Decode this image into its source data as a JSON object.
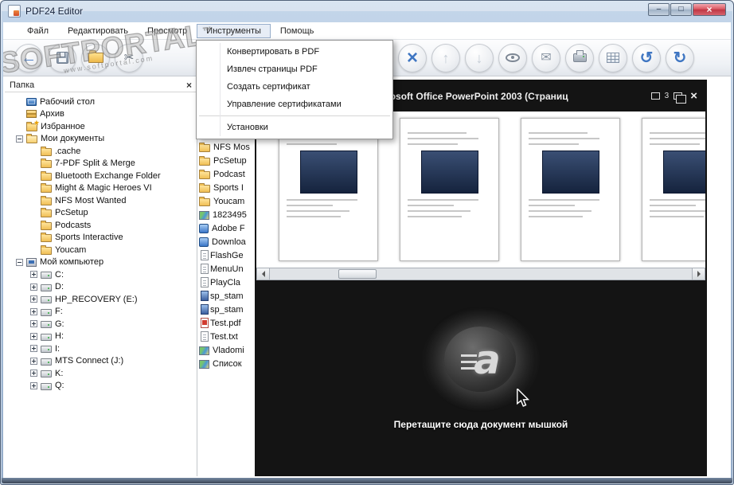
{
  "window": {
    "title": "PDF24 Editor",
    "controls": {
      "minimize": "–",
      "maximize": "□",
      "close": "×"
    }
  },
  "watermark": {
    "text": "SOFTPORTAL",
    "tm": "™",
    "subtext": "www.softportal.com"
  },
  "menubar": {
    "items": [
      {
        "label": "Файл",
        "active": false
      },
      {
        "label": "Редактировать",
        "active": false
      },
      {
        "label": "Просмотр",
        "active": false
      },
      {
        "label": "Инструменты",
        "active": true
      },
      {
        "label": "Помощь",
        "active": false
      }
    ]
  },
  "tools_menu": {
    "items": [
      {
        "label": "Конвертировать в PDF"
      },
      {
        "label": "Извлеч страницы PDF"
      },
      {
        "label": "Создать сертификат"
      },
      {
        "label": "Управление сертификатами"
      }
    ],
    "settings_item": {
      "label": "Установки"
    }
  },
  "toolbar": {
    "buttons": [
      {
        "name": "back",
        "icon": "arrow-left",
        "group": 1
      },
      {
        "name": "save",
        "icon": "save",
        "group": 1
      },
      {
        "name": "open-folder",
        "icon": "folder-open",
        "group": 1
      },
      {
        "name": "cut",
        "icon": "scissors",
        "group": 1
      },
      {
        "name": "close-document",
        "icon": "close-x",
        "group": 2
      },
      {
        "name": "page-up",
        "icon": "arrow-up",
        "group": 2
      },
      {
        "name": "page-down",
        "icon": "arrow-down",
        "group": 2
      },
      {
        "name": "preview",
        "icon": "eye",
        "group": 2
      },
      {
        "name": "email",
        "icon": "envelope",
        "group": 2
      },
      {
        "name": "print",
        "icon": "printer",
        "group": 2
      },
      {
        "name": "page-overview",
        "icon": "grid",
        "group": 2
      },
      {
        "name": "rotate-left",
        "icon": "rotate-left",
        "group": 2
      },
      {
        "name": "rotate-right",
        "icon": "rotate-right",
        "group": 2
      }
    ]
  },
  "folder_panel": {
    "title": "Папка",
    "close_label": "×",
    "tree": [
      {
        "label": "Рабочий стол",
        "icon": "desktop",
        "level": 0,
        "expander": "none"
      },
      {
        "label": "Архив",
        "icon": "archive",
        "level": 0,
        "expander": "none"
      },
      {
        "label": "Избранное",
        "icon": "favorites",
        "level": 0,
        "expander": "none"
      },
      {
        "label": "Мои документы",
        "icon": "folder-open",
        "level": 0,
        "expander": "minus"
      },
      {
        "label": ".cache",
        "icon": "folder",
        "level": 1,
        "expander": "none"
      },
      {
        "label": "7-PDF Split & Merge",
        "icon": "folder",
        "level": 1,
        "expander": "none"
      },
      {
        "label": "Bluetooth Exchange Folder",
        "icon": "folder",
        "level": 1,
        "expander": "none"
      },
      {
        "label": "Might & Magic Heroes VI",
        "icon": "folder",
        "level": 1,
        "expander": "none"
      },
      {
        "label": "NFS Most Wanted",
        "icon": "folder",
        "level": 1,
        "expander": "none"
      },
      {
        "label": "PcSetup",
        "icon": "folder",
        "level": 1,
        "expander": "none"
      },
      {
        "label": "Podcasts",
        "icon": "folder",
        "level": 1,
        "expander": "none"
      },
      {
        "label": "Sports Interactive",
        "icon": "folder",
        "level": 1,
        "expander": "none"
      },
      {
        "label": "Youcam",
        "icon": "folder",
        "level": 1,
        "expander": "none"
      },
      {
        "label": "Мой компьютер",
        "icon": "computer",
        "level": 0,
        "expander": "minus"
      },
      {
        "label": "C:",
        "icon": "drive",
        "level": 1,
        "expander": "plus"
      },
      {
        "label": "D:",
        "icon": "drive",
        "level": 1,
        "expander": "plus"
      },
      {
        "label": "HP_RECOVERY (E:)",
        "icon": "drive",
        "level": 1,
        "expander": "plus"
      },
      {
        "label": "F:",
        "icon": "drive",
        "level": 1,
        "expander": "plus"
      },
      {
        "label": "G:",
        "icon": "drive",
        "level": 1,
        "expander": "plus"
      },
      {
        "label": "H:",
        "icon": "drive",
        "level": 1,
        "expander": "plus"
      },
      {
        "label": "I:",
        "icon": "drive",
        "level": 1,
        "expander": "plus"
      },
      {
        "label": "MTS Connect (J:)",
        "icon": "drive",
        "level": 1,
        "expander": "plus"
      },
      {
        "label": "K:",
        "icon": "drive",
        "level": 1,
        "expander": "plus"
      },
      {
        "label": "Q:",
        "icon": "drive",
        "level": 1,
        "expander": "plus"
      }
    ]
  },
  "file_list": {
    "items": [
      {
        "label": "NFS Mos",
        "icon": "folder"
      },
      {
        "label": "PcSetup",
        "icon": "folder"
      },
      {
        "label": "Podcast",
        "icon": "folder"
      },
      {
        "label": "Sports I",
        "icon": "folder"
      },
      {
        "label": "Youcam",
        "icon": "folder"
      },
      {
        "label": "1823495",
        "icon": "jpg"
      },
      {
        "label": "Adobe F",
        "icon": "app"
      },
      {
        "label": "Downloa",
        "icon": "app"
      },
      {
        "label": "FlashGe",
        "icon": "doc"
      },
      {
        "label": "MenuUn",
        "icon": "doc"
      },
      {
        "label": "PlayCla",
        "icon": "doc"
      },
      {
        "label": "sp_stam",
        "icon": "psd"
      },
      {
        "label": "sp_stam",
        "icon": "psd"
      },
      {
        "label": "Test.pdf",
        "icon": "pdf"
      },
      {
        "label": "Test.txt",
        "icon": "txt"
      },
      {
        "label": "Vladomi",
        "icon": "jpg"
      },
      {
        "label": "Список",
        "icon": "jpg"
      }
    ]
  },
  "preview": {
    "doc_title": "...с Microsoft. Microsoft Office PowerPoint 2003 (Страниц",
    "page_badge": "3",
    "close_label": "×",
    "thumbnail_count": 4,
    "logo_letter": "a",
    "drop_hint": "Перетащите сюда документ мышкой"
  }
}
